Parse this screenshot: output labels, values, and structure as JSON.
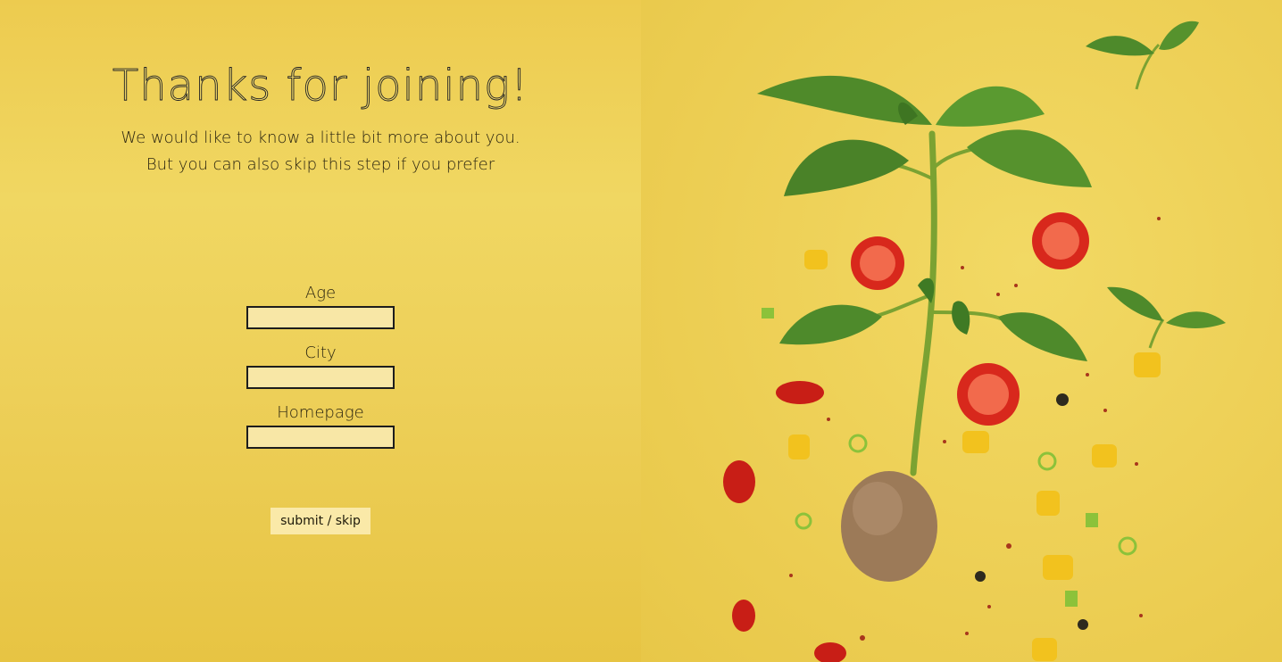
{
  "header": {
    "title": "Thanks for joining!",
    "subtitle_line1": "We would like to know a little bit more about you.",
    "subtitle_line2": "But you can also skip this step if you prefer"
  },
  "form": {
    "fields": [
      {
        "label": "Age",
        "value": ""
      },
      {
        "label": "City",
        "value": ""
      },
      {
        "label": "Homepage",
        "value": ""
      }
    ],
    "submit_label": "submit / skip"
  },
  "image": {
    "icon": "plant-sprouting-from-seed-with-vegetables-illustration"
  },
  "colors": {
    "background": "#EDCF55",
    "input_bg": "#F8E7A6",
    "button_bg": "#FAE9A8",
    "text": "#2a2410"
  }
}
